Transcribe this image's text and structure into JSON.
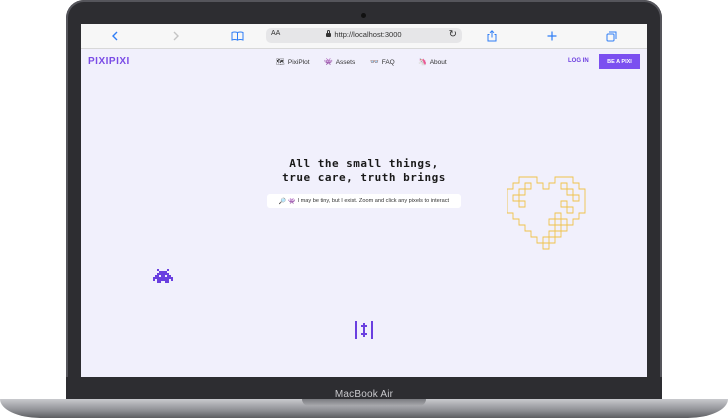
{
  "device": {
    "model_label": "MacBook Air"
  },
  "browser": {
    "text_size_label": "AA",
    "url": "http://localhost:3000",
    "icons": [
      "chevron-left-icon",
      "chevron-right-icon",
      "book-icon",
      "lock-icon",
      "reload-icon",
      "share-icon",
      "plus-icon",
      "tabs-icon"
    ]
  },
  "nav": {
    "logo": "PIXIPIXI",
    "items": [
      {
        "icon": "🗺",
        "label": "PixiPlot"
      },
      {
        "icon": "👾",
        "label": "Assets"
      },
      {
        "icon": "👓",
        "label": "FAQ"
      },
      {
        "icon": "🦄",
        "label": "About"
      }
    ],
    "login": "LOG IN",
    "cta": "BE A PIXI"
  },
  "hero": {
    "line1": "All the small things,",
    "line2": "true care, truth brings",
    "hint_icons": "🔎 👾",
    "hint": "I may be tiny, but I exist. Zoom and click any pixels to interact"
  },
  "colors": {
    "accent": "#7b4ff0",
    "page_bg": "#f1f0fc",
    "heart_outline": "#f0c24a",
    "browser_blue": "#2f7ef6"
  }
}
